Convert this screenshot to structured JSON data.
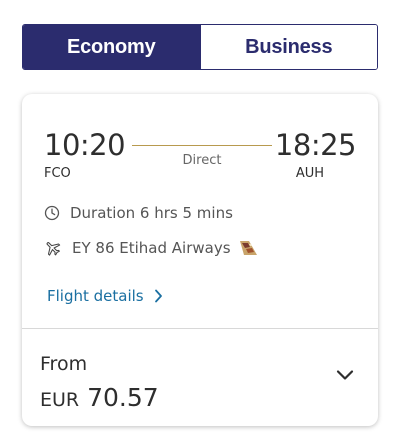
{
  "cabin_toggle": {
    "options": [
      {
        "label": "Economy",
        "selected": true
      },
      {
        "label": "Business",
        "selected": false
      }
    ]
  },
  "flight": {
    "departure_time": "10:20",
    "departure_code": "FCO",
    "arrival_time": "18:25",
    "arrival_code": "AUH",
    "stops_label": "Direct",
    "duration_text": "Duration 6 hrs 5 mins",
    "flight_text": "EY 86 Etihad Airways",
    "details_link_label": "Flight details"
  },
  "fare": {
    "from_label": "From",
    "currency": "EUR",
    "amount": "70.57"
  },
  "icons": {
    "duration": "clock-icon",
    "flight": "airplane-icon",
    "airline_logo": "etihad-tail-logo",
    "details_chevron": "chevron-right-icon",
    "expand": "chevron-down-icon"
  },
  "colors": {
    "brand_navy": "#2b2c6e",
    "link_blue": "#1a6fa1",
    "route_line_gold": "#b89a4e"
  }
}
